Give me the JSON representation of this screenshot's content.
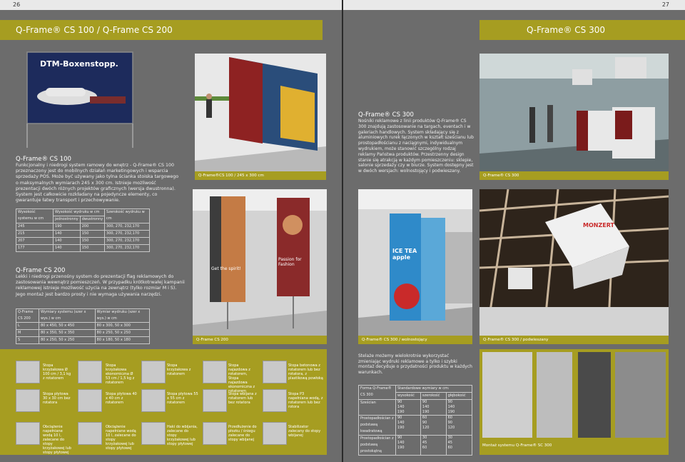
{
  "page_numbers": {
    "left": "26",
    "right": "27"
  },
  "headers": {
    "left": "Q-Frame® CS 100 / Q-Frame CS 200",
    "right": "Q-Frame® CS 300"
  },
  "cs100": {
    "banner_text": "DTM-Boxenstopp.",
    "title": "Q-Frame® CS 100",
    "text": "Funkcjonalny i niedrogi system ramowy do wnętrz - Q-Frame® CS 100 przeznaczony jest do mobilnych działań marketingowych i wsparcia sprzedaży POS. Może być używany jako tylna ścianka stoiska targowego o maksymalnych wymiarach 245 x 300 cm. Istnieje możliwość prezentacji dwóch różnych projektów graficznych (wersja dwustronna). System jest całkowicie rozkładany na pojedyncze elementy, co gwarantuje łatwy transport i przechowywanie.",
    "caption": "Q-Frame®CS 100 / 245 x 300 cm",
    "table": {
      "h1": "Wysokość systemu w cm",
      "h2": "Wysokość wydruku w cm",
      "h3": "Szerokość wydruku w cm",
      "s1": "jednostronny",
      "s2": "dwustronny",
      "rows": [
        [
          "245",
          "190",
          "200",
          "300, 270, 232,170"
        ],
        [
          "215",
          "140",
          "150",
          "300, 270, 232,170"
        ],
        [
          "207",
          "140",
          "150",
          "300, 270, 232,170"
        ],
        [
          "177",
          "140",
          "150",
          "300, 270, 232,170"
        ]
      ]
    }
  },
  "cs200": {
    "title": "Q-Frame CS 200",
    "text": "Lekki i niedrogi przenośny system do prezentacji flag reklamowych do zastosowania wewnątrz pomieszczeń. W przypadku krótkotrwałej kampanii reklamowej istnieje możliwość użycia na zewnątrz (tylko rozmiar M i S). Jego montaż jest bardzo prosty i nie wymaga używania narzędzi.",
    "caption": "Q-Frame CS 200",
    "poster1": "Get the spirit!",
    "poster2": "Passion for Fashion",
    "table": {
      "h1": "Q-Frame CS 200",
      "h2": "Wymiary systemu (szer x wys.) w cm",
      "h3": "Wymiar wydruku (szer x wys.) w cm",
      "rows": [
        [
          "L",
          "80 x 450, 50 x 450",
          "80 x 300, 50 x 300"
        ],
        [
          "M",
          "80 x 350, 50 x 350",
          "80 x 250, 50 x 250"
        ],
        [
          "S",
          "80 x 250, 50 x 250",
          "80 x 180, 50 x 180"
        ]
      ]
    }
  },
  "cs300": {
    "title": "Q-Frame® CS 300",
    "text": "Nośniki reklamowe z linii produktów Q-Frame® CS 300 znajdują zastosowanie na targach, eventach i w galeriach handlowych. System składający się z aluminiowych rurek łączonych w kształt sześcianu lub prostopadłościanu z naciągnymi, indywidualnym wydrukiem, może stanowić szczególny rodzaj reklamy Państwa produktów. Przestrzenny design stanie się atrakcją w każdym pomieszczeniu: sklepie, salonie sprzedaży czy w biurze. System dostępny jest w dwóch wersjach: wolnostojący i podwieszany.",
    "caption_top": "Q-Frame® CS 300",
    "caption_free": "Q-Frame® CS 300 / wolnostojący",
    "caption_hang": "Q-Frame® CS 300 / podwieszany",
    "freestanding_text": "ICE TEA apple",
    "hanging_text": "MONZERT",
    "strip_text": "Stelaże możemy wielokrotnie wykorzystać zmieniając wydruki reklamowe a tylko i szybki montaż decyduje o przydatności produktu w każdych warunkach.",
    "table": {
      "h1": "Forma Q-Frame® CS 300",
      "h2": "Standardowe wymiary w cm:",
      "c1": "wysokość",
      "c2": "szerokość",
      "c3": "głębokość",
      "rows": [
        [
          "Sześcian",
          "90\n140\n190",
          "90\n140\n190",
          "90\n140\n190"
        ],
        [
          "Prostopadłościan z podstawą kwadratową",
          "90\n140\n190",
          "60\n90\n120",
          "60\n90\n120"
        ],
        [
          "Prostopadłościan z podstawą prostokątną",
          "90\n140\n190",
          "30\n45\n60",
          "30\n45\n60"
        ]
      ]
    },
    "assembly_caption": "Montaż systemu Q-Frame® SC 300"
  },
  "accessories": [
    [
      "Stopa krzyżakowa Ø 100 cm / 3,1 kg z rotatorem",
      "Stopa krzyżakowa ekonomiczna Ø 53 cm / 1,5 kg z rotatorem",
      "Stopa krzyżakowa z rotatorem",
      "Stopa najazdowa Ø100 cm / 17 kg z rotatorem",
      "Stopa najazdowa z rotatorem, Stopa najazdowa ekonomiczna z rotatorem",
      "Stopa betonowa z rotatorem lub bez rotatora, z plastikową powłoką"
    ],
    [
      "Stopa płytowa 30 x 30 cm bez rotatora",
      "Stopa płytowa 40 x 40 cm z rotatorem",
      "Stopa płytowa 40 x 40 cm z rotatorem",
      "Stopa płytowa 55 x 55 cm z rotatorem",
      "Stopa wbijana z rotatorem lub bez rotatora",
      "Stopa P3 napełniana wodą, z rotatorem lub bez rotora"
    ],
    [
      "Obciążenie napełniane wodą 10 l, zalecane do stopy krzyżakowej lub stopy płytowej",
      "Obciążenie napełniane wodą 10 l, zalecane do stopy krzyżakowej lub stopy płytowej",
      "Haki do wbijania, zalecane do stopy krzyżakowej lub stopy płytowej",
      "Przedłużenie do płozku / śniegu zalecane do stopy wbijanej",
      "Stabilizator zalecany do stopy wbijanej",
      ""
    ]
  ]
}
